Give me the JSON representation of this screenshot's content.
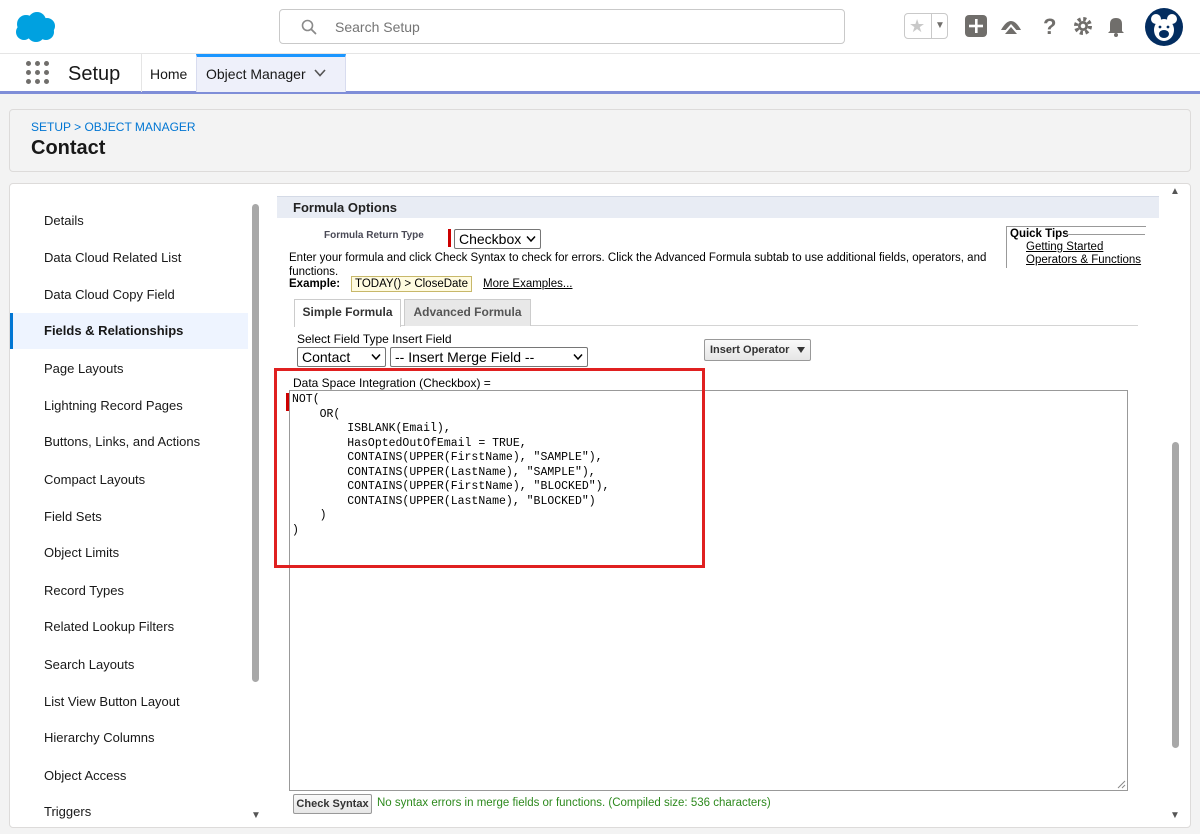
{
  "header": {
    "search_placeholder": "Search Setup",
    "icons": [
      "salesforce-logo",
      "search-icon",
      "star-icon",
      "add-icon",
      "trailhead-icon",
      "help-icon",
      "gear-icon",
      "bell-icon",
      "avatar"
    ]
  },
  "appnav": {
    "app_name": "Setup",
    "home_label": "Home",
    "active_tab": "Object Manager"
  },
  "page": {
    "breadcrumb": "SETUP > OBJECT MANAGER",
    "title": "Contact"
  },
  "sidebar": {
    "items": [
      {
        "label": "Details"
      },
      {
        "label": "Data Cloud Related List"
      },
      {
        "label": "Data Cloud Copy Field"
      },
      {
        "label": "Fields & Relationships",
        "active": true
      },
      {
        "label": "Page Layouts"
      },
      {
        "label": "Lightning Record Pages"
      },
      {
        "label": "Buttons, Links, and Actions"
      },
      {
        "label": "Compact Layouts"
      },
      {
        "label": "Field Sets"
      },
      {
        "label": "Object Limits"
      },
      {
        "label": "Record Types"
      },
      {
        "label": "Related Lookup Filters"
      },
      {
        "label": "Search Layouts"
      },
      {
        "label": "List View Button Layout"
      },
      {
        "label": "Hierarchy Columns"
      },
      {
        "label": "Object Access"
      },
      {
        "label": "Triggers"
      }
    ]
  },
  "formula": {
    "section_title": "Formula Options",
    "return_type_label": "Formula Return Type",
    "return_type_value": "Checkbox",
    "instructions": "Enter your formula and click Check Syntax to check for errors. Click the Advanced Formula subtab to use additional fields, operators, and functions.",
    "example_label": "Example:",
    "example_value": "TODAY() > CloseDate",
    "more_examples": "More Examples...",
    "quick_tips": {
      "title": "Quick Tips",
      "links": [
        "Getting Started",
        "Operators & Functions"
      ]
    },
    "tabs": [
      "Simple Formula",
      "Advanced Formula"
    ],
    "field_type_label": "Select Field Type Insert Field",
    "field_type_value": "Contact",
    "merge_field_value": "-- Insert Merge Field --",
    "insert_operator": "Insert Operator",
    "field_label": "Data Space Integration (Checkbox) =",
    "code": "NOT(\n    OR(\n        ISBLANK(Email),\n        HasOptedOutOfEmail = TRUE,\n        CONTAINS(UPPER(FirstName), \"SAMPLE\"),\n        CONTAINS(UPPER(LastName), \"SAMPLE\"),\n        CONTAINS(UPPER(FirstName), \"BLOCKED\"),\n        CONTAINS(UPPER(LastName), \"BLOCKED\")\n    )\n)",
    "check_syntax": "Check Syntax",
    "check_message": "No syntax errors in merge fields or functions. (Compiled size: 536 characters)"
  },
  "colors": {
    "brand": "#0176d3",
    "highlight": "#e02020",
    "success": "#2e8a1e"
  }
}
